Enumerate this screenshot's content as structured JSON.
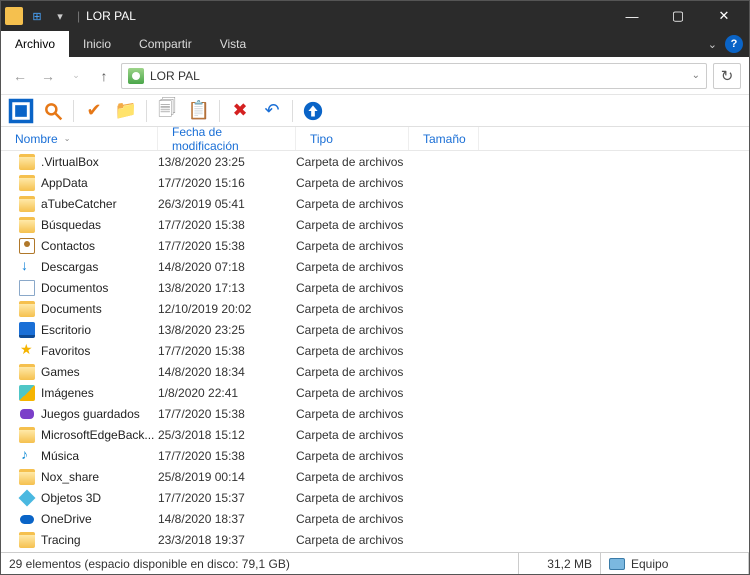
{
  "window": {
    "title": "LOR PAL"
  },
  "menu": {
    "file": "Archivo",
    "home": "Inicio",
    "share": "Compartir",
    "view": "Vista"
  },
  "breadcrumb": {
    "location": "LOR PAL"
  },
  "columns": {
    "name": "Nombre",
    "date": "Fecha de modificación",
    "type": "Tipo",
    "size": "Tamaño"
  },
  "type_label": "Carpeta de archivos",
  "files": [
    {
      "icon": "ic-folder",
      "name": ".VirtualBox",
      "date": "13/8/2020 23:25"
    },
    {
      "icon": "ic-folder",
      "name": "AppData",
      "date": "17/7/2020 15:16"
    },
    {
      "icon": "ic-folder",
      "name": "aTubeCatcher",
      "date": "26/3/2019 05:41"
    },
    {
      "icon": "ic-folder",
      "name": "Búsquedas",
      "date": "17/7/2020 15:38"
    },
    {
      "icon": "ic-contacts",
      "name": "Contactos",
      "date": "17/7/2020 15:38"
    },
    {
      "icon": "ic-download",
      "name": "Descargas",
      "date": "14/8/2020 07:18"
    },
    {
      "icon": "ic-docs",
      "name": "Documentos",
      "date": "13/8/2020 17:13"
    },
    {
      "icon": "ic-folder",
      "name": "Documents",
      "date": "12/10/2019 20:02"
    },
    {
      "icon": "ic-desktop",
      "name": "Escritorio",
      "date": "13/8/2020 23:25"
    },
    {
      "icon": "ic-fav",
      "name": "Favoritos",
      "date": "17/7/2020 15:38"
    },
    {
      "icon": "ic-folder",
      "name": "Games",
      "date": "14/8/2020 18:34"
    },
    {
      "icon": "ic-img",
      "name": "Imágenes",
      "date": "1/8/2020 22:41"
    },
    {
      "icon": "ic-game",
      "name": "Juegos guardados",
      "date": "17/7/2020 15:38"
    },
    {
      "icon": "ic-folder",
      "name": "MicrosoftEdgeBack...",
      "date": "25/3/2018 15:12"
    },
    {
      "icon": "ic-music",
      "name": "Música",
      "date": "17/7/2020 15:38"
    },
    {
      "icon": "ic-folder",
      "name": "Nox_share",
      "date": "25/8/2019 00:14"
    },
    {
      "icon": "ic-3d",
      "name": "Objetos 3D",
      "date": "17/7/2020 15:37"
    },
    {
      "icon": "ic-cloud",
      "name": "OneDrive",
      "date": "14/8/2020 18:37"
    },
    {
      "icon": "ic-folder",
      "name": "Tracing",
      "date": "23/3/2018 19:37"
    }
  ],
  "status": {
    "main": "29 elementos (espacio disponible en disco: 79,1 GB)",
    "size": "31,2 MB",
    "pc": "Equipo"
  }
}
